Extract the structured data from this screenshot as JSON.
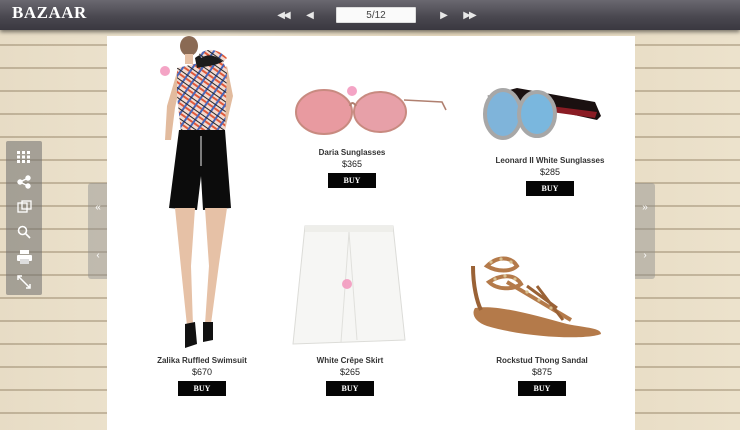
{
  "header": {
    "brand": "BAZAAR",
    "page_indicator": "5/12",
    "nav": {
      "first_icon": "double-chevron-left-icon",
      "prev_icon": "chevron-left-icon",
      "next_icon": "chevron-right-icon",
      "last_icon": "double-chevron-right-icon"
    }
  },
  "toolbar": {
    "tools": [
      "thumbnails-grid-icon",
      "share-icon",
      "pages-icon",
      "zoom-icon",
      "print-icon",
      "fullscreen-icon"
    ]
  },
  "colors": {
    "topbar": "#4a4850",
    "buy_button": "#050505",
    "hotspot": "#f39abf"
  },
  "products": [
    {
      "name": "Zalika Ruffled Swimsuit",
      "price": "$670",
      "buy": "BUY"
    },
    {
      "name": "Daria Sunglasses",
      "price": "$365",
      "buy": "BUY"
    },
    {
      "name": "Leonard II White Sunglasses",
      "price": "$285",
      "buy": "BUY"
    },
    {
      "name": "White Crêpe Skirt",
      "price": "$265",
      "buy": "BUY"
    },
    {
      "name": "Rockstud Thong Sandal",
      "price": "$875",
      "buy": "BUY"
    }
  ]
}
